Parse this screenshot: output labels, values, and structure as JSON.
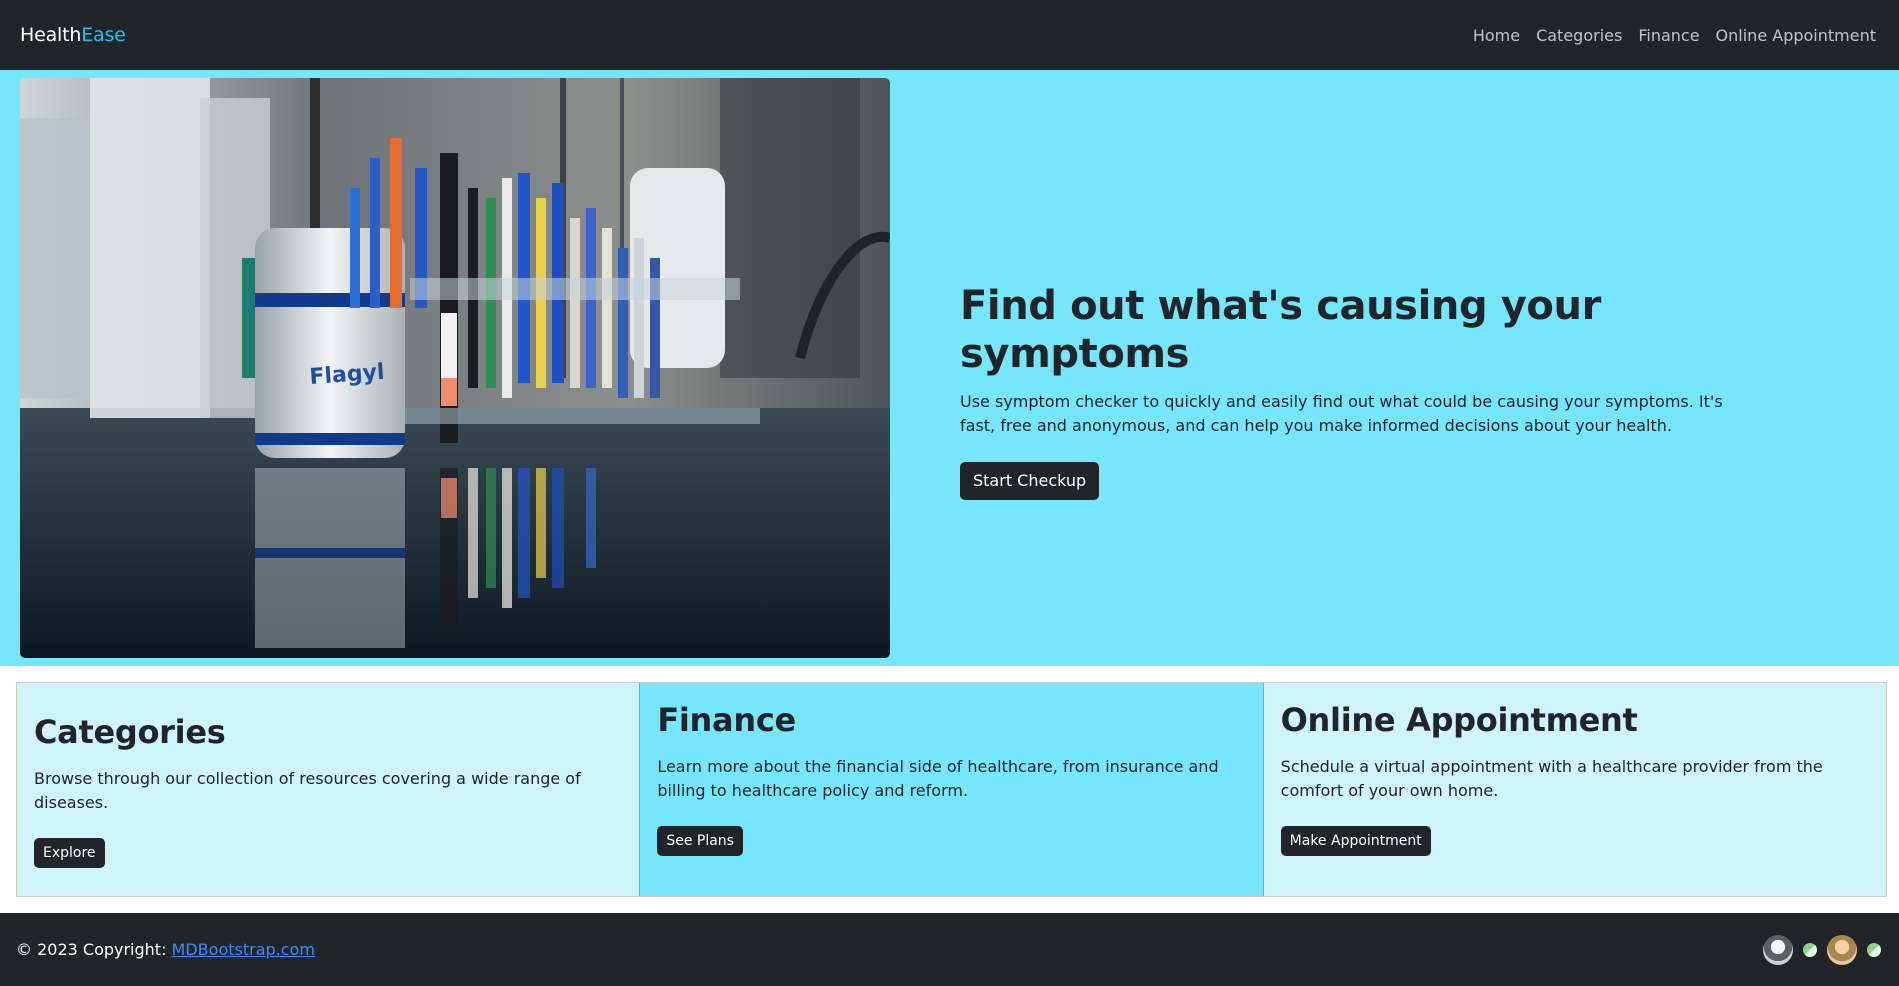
{
  "navbar": {
    "brand_main": "Health",
    "brand_accent": "Ease",
    "links": [
      "Home",
      "Categories",
      "Finance",
      "Online Appointment"
    ]
  },
  "hero": {
    "title": "Find out what's causing your symptoms",
    "description": "Use symptom checker to quickly and easily find out what could be causing your symptoms. It's fast, free and anonymous, and can help you make informed decisions about your health.",
    "button": "Start Checkup",
    "image_label": "Flagyl"
  },
  "cards": [
    {
      "title": "Categories",
      "text": "Browse through our collection of resources covering a wide range of diseases.",
      "button": "Explore"
    },
    {
      "title": "Finance",
      "text": "Learn more about the financial side of healthcare, from insurance and billing to healthcare policy and reform.",
      "button": "See Plans"
    },
    {
      "title": "Online Appointment",
      "text": "Schedule a virtual appointment with a healthcare provider from the comfort of your own home.",
      "button": "Make Appointment"
    }
  ],
  "footer": {
    "copyright": "© 2023 Copyright: ",
    "link": "MDBootstrap.com",
    "social_icons": [
      "avatar-icon",
      "globe-icon",
      "avatar-icon",
      "globe-icon"
    ]
  },
  "colors": {
    "dark": "#212529",
    "accent": "#0dcaf0",
    "hero_bg": "#75e6fb",
    "card_light": "#cff4fc",
    "link": "#3d8bfd"
  }
}
